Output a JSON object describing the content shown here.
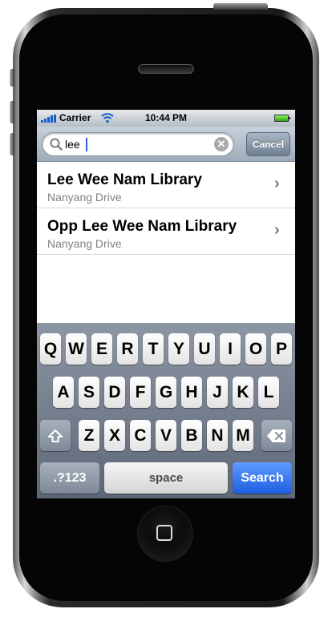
{
  "status_bar": {
    "carrier": "Carrier",
    "time": "10:44 PM"
  },
  "search": {
    "value": "lee",
    "cancel_label": "Cancel"
  },
  "results": [
    {
      "title": "Lee Wee Nam Library",
      "subtitle": "Nanyang Drive"
    },
    {
      "title": "Opp Lee Wee Nam Library",
      "subtitle": "Nanyang Drive"
    }
  ],
  "keyboard": {
    "row1": [
      "Q",
      "W",
      "E",
      "R",
      "T",
      "Y",
      "U",
      "I",
      "O",
      "P"
    ],
    "row2": [
      "A",
      "S",
      "D",
      "F",
      "G",
      "H",
      "J",
      "K",
      "L"
    ],
    "row3": [
      "Z",
      "X",
      "C",
      "V",
      "B",
      "N",
      "M"
    ],
    "numbers_label": ".?123",
    "space_label": "space",
    "search_label": "Search"
  },
  "icons": [
    "signal-icon",
    "wifi-icon",
    "battery-icon",
    "magnifier-icon",
    "clear-icon",
    "chevron-right-icon",
    "shift-icon",
    "backspace-icon",
    "home-button-icon"
  ]
}
